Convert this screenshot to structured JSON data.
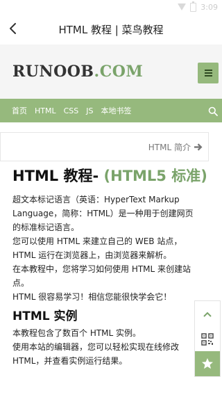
{
  "status_bar": {
    "time": "3:09"
  },
  "app_bar": {
    "title": "HTML 教程 | 菜鸟教程"
  },
  "site_header": {
    "logo_main": "RUNOOB",
    "logo_dot": ".",
    "logo_com": "COM"
  },
  "nav": {
    "items": [
      "首页",
      "HTML",
      "CSS",
      "JS",
      "本地书签"
    ]
  },
  "breadcrumb": {
    "next_label": "HTML 简介"
  },
  "article": {
    "title_main": "HTML 教程- ",
    "title_accent": "(HTML5 标准)",
    "paragraphs": [
      "超文本标记语言（英语：HyperText Markup Language，简称：HTML）是一种用于创建网页的标准标记语言。",
      "您可以使用 HTML 来建立自己的 WEB 站点，HTML 运行在浏览器上，由浏览器来解析。",
      "在本教程中，您将学习如何使用 HTML 来创建站点。",
      "HTML 很容易学习！相信您能很快学会它！"
    ],
    "section_title": "HTML 实例",
    "section_paragraphs": [
      "本教程包含了数百个 HTML 实例。",
      "使用本站的编辑器，您可以轻松实现在线修改 HTML，并查看实例运行结果。"
    ]
  },
  "colors": {
    "accent": "#96b97d",
    "accent_text": "#7aa36a"
  }
}
